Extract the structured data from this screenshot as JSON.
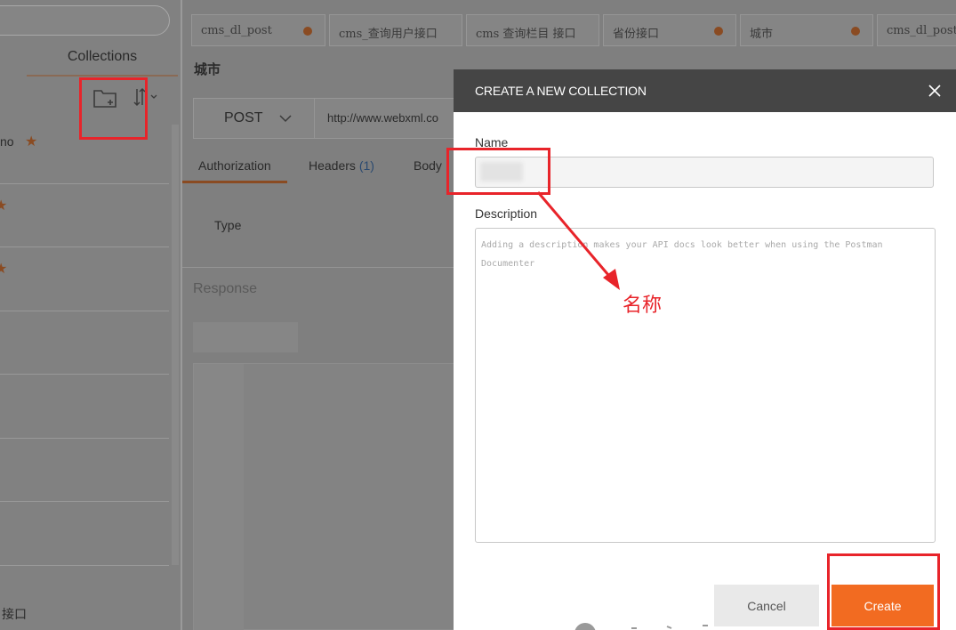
{
  "sidebar": {
    "collections_tab": "Collections",
    "items": [
      {
        "label": "no",
        "starred": true
      },
      {
        "label": "",
        "starred": true
      },
      {
        "label": "",
        "starred": true
      },
      {
        "label": "",
        "starred": false
      },
      {
        "label": "",
        "starred": false
      },
      {
        "label": "",
        "starred": false
      },
      {
        "label": "",
        "starred": false
      }
    ],
    "bottom_label": "接口"
  },
  "tabs": [
    {
      "label": "cms_dl_post",
      "dot": true
    },
    {
      "label": "cms_查询用户接口",
      "dot": false
    },
    {
      "label": "cms 查询栏目 接口",
      "dot": false
    },
    {
      "label": "省份接口",
      "dot": true
    },
    {
      "label": "城市",
      "dot": true
    },
    {
      "label": "cms_dl_post",
      "dot": false
    }
  ],
  "request": {
    "title": "城市",
    "method": "POST",
    "url": "http://www.webxml.co",
    "sub_tabs": {
      "authorization": "Authorization",
      "headers": "Headers",
      "headers_count": "(1)",
      "body": "Body"
    },
    "type_label": "Type",
    "response_label": "Response"
  },
  "modal": {
    "title": "CREATE A NEW COLLECTION",
    "name_label": "Name",
    "name_value": "",
    "description_label": "Description",
    "description_placeholder": "Adding a description makes your API docs look better when using the Postman Documenter",
    "cancel_label": "Cancel",
    "create_label": "Create"
  },
  "annotation": {
    "text": "名称",
    "color": "#e8242a"
  },
  "colors": {
    "accent": "#f26b21",
    "modal_header": "#454545",
    "annotation": "#e8242a"
  }
}
